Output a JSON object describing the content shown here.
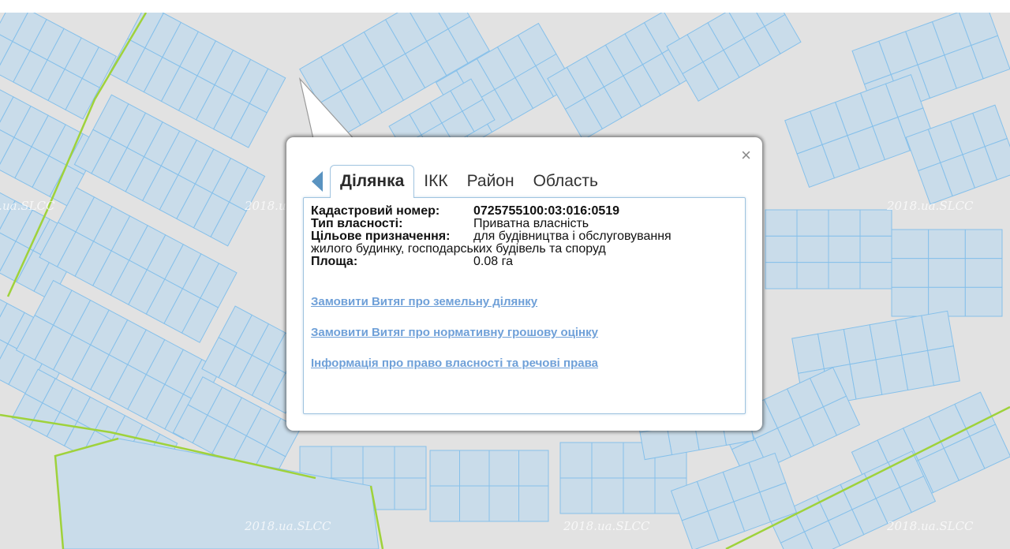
{
  "map": {
    "watermark_text": "2018.ua.SLCC",
    "colors": {
      "background": "#e2e2e2",
      "parcel_fill": "#c9dcea",
      "parcel_stroke": "#86c0ea",
      "boundary_line": "#9fd23b"
    }
  },
  "popup": {
    "close_label": "×",
    "tabs": [
      {
        "label": "Ділянка",
        "active": true
      },
      {
        "label": "ІКК",
        "active": false
      },
      {
        "label": "Район",
        "active": false
      },
      {
        "label": "Область",
        "active": false
      }
    ],
    "parcel": {
      "cadastral_label": "Кадастровий номер:",
      "cadastral_value": "0725755100:03:016:0519",
      "ownership_label": "Тип власності:",
      "ownership_value": "Приватна власність",
      "purpose_label": "Цільове призначення:",
      "purpose_value_line1": "для будівництва і обслуговування",
      "purpose_value_line2": "жилого будинку, господарських будівель та споруд",
      "area_label": "Площа:",
      "area_value": "0.08 га"
    },
    "links": [
      "Замовити Витяг про земельну ділянку",
      "Замовити Витяг про нормативну грошову оцінку",
      "Інформація про право власності та речові права"
    ]
  }
}
